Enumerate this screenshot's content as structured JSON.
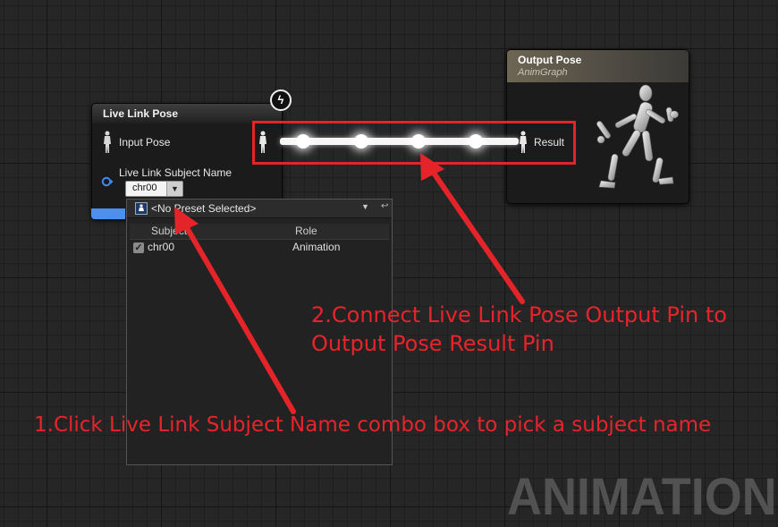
{
  "live_link_node": {
    "title": "Live Link Pose",
    "input_pin_label": "Input Pose",
    "subject_name_label": "Live Link Subject Name",
    "subject_combo_value": "chr00"
  },
  "output_node": {
    "title": "Output Pose",
    "subtitle": "AnimGraph",
    "result_pin_label": "Result"
  },
  "subject_picker": {
    "preset_label": "<No Preset Selected>",
    "columns": [
      "Subject",
      "Role"
    ],
    "rows": [
      {
        "checked": true,
        "subject": "chr00",
        "role": "Animation"
      }
    ]
  },
  "annotations": {
    "step1": "1.Click Live Link Subject Name combo box to pick a subject name",
    "step2_line1": "2.Connect Live Link Pose Output Pin to",
    "step2_line2": "Output Pose Result Pin",
    "color": "#e5242a"
  },
  "watermark": "ANIMATION",
  "colors": {
    "graph_bg": "#262626",
    "output_header": "#6e6654",
    "exec_footer": "#4b8ff0"
  }
}
